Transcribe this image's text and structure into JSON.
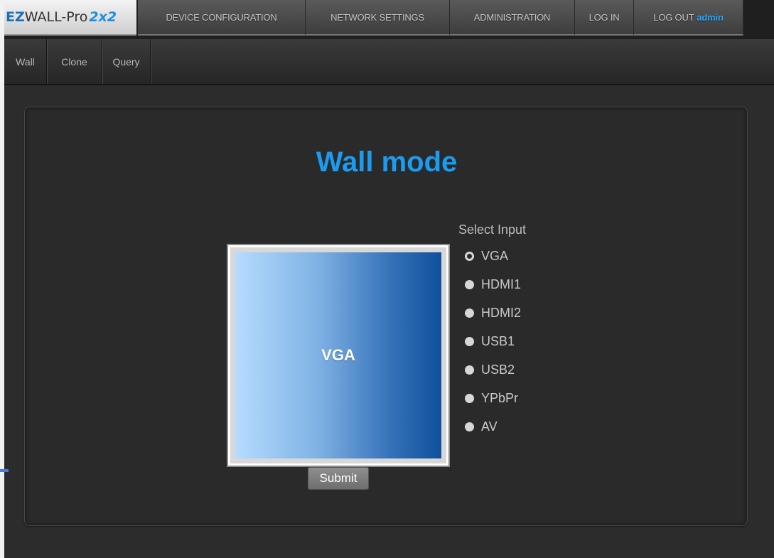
{
  "header": {
    "brand": {
      "prefix": "EZ",
      "name": "WALL-Pro",
      "model": "2x2"
    },
    "nav": [
      {
        "label": "DEVICE CONFIGURATION"
      },
      {
        "label": "NETWORK SETTINGS"
      },
      {
        "label": "ADMINISTRATION"
      },
      {
        "label": "LOG IN"
      },
      {
        "label": "LOG OUT",
        "user": "admin"
      }
    ]
  },
  "subnav": [
    {
      "label": "Wall"
    },
    {
      "label": "Clone"
    },
    {
      "label": "Query"
    }
  ],
  "main": {
    "title": "Wall mode",
    "screen_label": "VGA",
    "submit_label": "Submit",
    "select_input_label": "Select Input",
    "inputs": [
      {
        "label": "VGA",
        "checked": true
      },
      {
        "label": "HDMI1",
        "checked": false
      },
      {
        "label": "HDMI2",
        "checked": false
      },
      {
        "label": "USB1",
        "checked": false
      },
      {
        "label": "USB2",
        "checked": false
      },
      {
        "label": "YPbPr",
        "checked": false
      },
      {
        "label": "AV",
        "checked": false
      }
    ]
  },
  "colors": {
    "accent": "#1a9cf0",
    "background": "#2c2c2c",
    "admin": "#29a4ff"
  }
}
